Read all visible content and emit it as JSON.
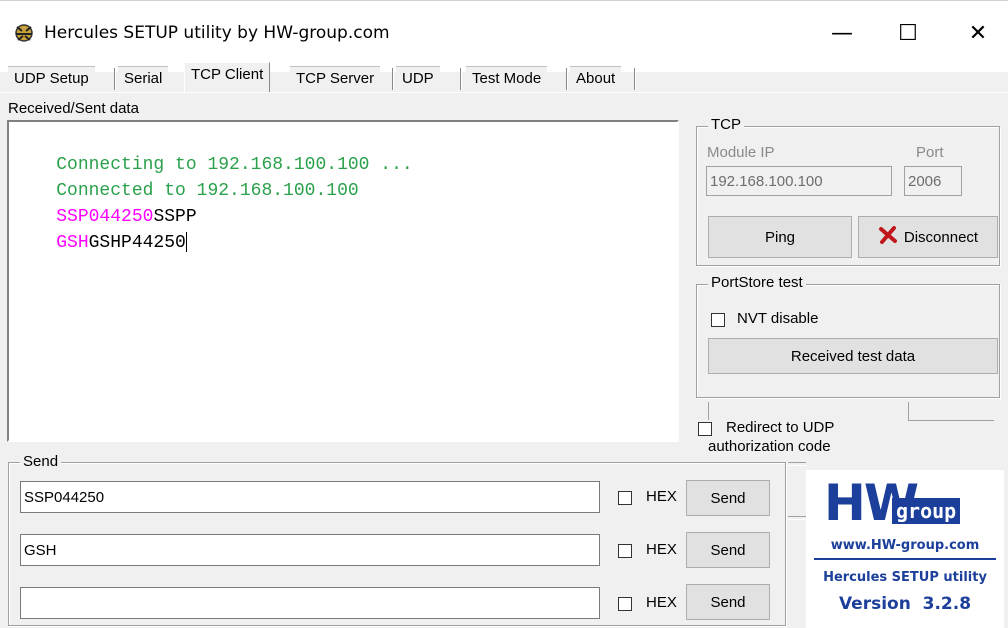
{
  "window": {
    "title": "Hercules SETUP utility by HW-group.com",
    "minimize": "—",
    "maximize": "☐",
    "close": "✕"
  },
  "tabs": [
    "UDP Setup",
    "Serial",
    "TCP Client",
    "TCP Server",
    "UDP",
    "Test Mode",
    "About"
  ],
  "active_tab": "TCP Client",
  "received": {
    "label": "Received/Sent data",
    "lines": [
      {
        "segments": [
          {
            "text": "Connecting to 192.168.100.100 ...",
            "color": "green"
          }
        ]
      },
      {
        "segments": [
          {
            "text": "Connected to 192.168.100.100",
            "color": "green"
          }
        ]
      },
      {
        "segments": [
          {
            "text": "SSP044250",
            "color": "magenta"
          },
          {
            "text": "SSPP",
            "color": "black"
          }
        ]
      },
      {
        "segments": [
          {
            "text": "GSH",
            "color": "magenta"
          },
          {
            "text": "GSHP44250",
            "color": "black"
          }
        ]
      }
    ]
  },
  "tcp": {
    "label": "TCP",
    "module_ip_label": "Module IP",
    "port_label": "Port",
    "module_ip": "192.168.100.100",
    "port": "2006",
    "ping": "Ping",
    "disconnect": "Disconnect"
  },
  "portstore": {
    "label": "PortStore test",
    "nvt_disable": "NVT disable",
    "received_test_data": "Received test data"
  },
  "redirect": {
    "label": "Redirect to UDP",
    "auth": "authorization code"
  },
  "send": {
    "label": "Send",
    "hex_label": "HEX",
    "button": "Send",
    "rows": [
      {
        "value": "SSP044250"
      },
      {
        "value": "GSH"
      },
      {
        "value": ""
      }
    ]
  },
  "logo": {
    "hw": "HW",
    "group": "group",
    "url": "www.HW-group.com",
    "app": "Hercules SETUP utility",
    "version": "Version  3.2.8"
  },
  "colors": {
    "green": "#2aa14a",
    "magenta": "#ff00ff",
    "logo_blue": "#1b3f9b",
    "disconnect_icon": "#c0161b"
  }
}
